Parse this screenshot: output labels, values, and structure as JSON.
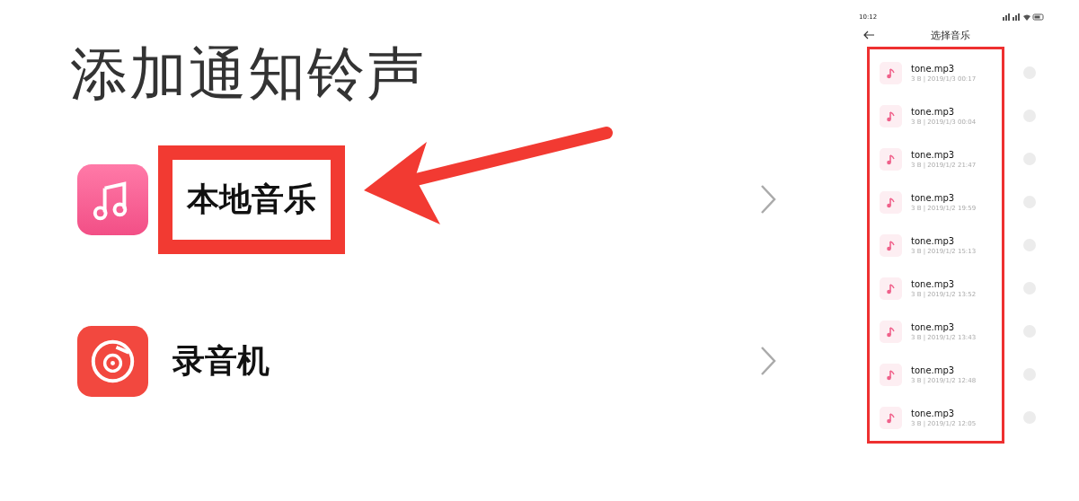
{
  "title": "添加通知铃声",
  "sources": [
    {
      "kind": "music",
      "label": "本地音乐",
      "highlighted": true
    },
    {
      "kind": "recorder",
      "label": "录音机",
      "highlighted": false
    }
  ],
  "phone": {
    "status_bar": {
      "time": "10:12"
    },
    "header": {
      "title": "选择音乐"
    },
    "list_highlighted": true,
    "files": [
      {
        "name": "tone.mp3",
        "meta": "3 B | 2019/1/3 00:17",
        "selected": false
      },
      {
        "name": "tone.mp3",
        "meta": "3 B | 2019/1/3 00:04",
        "selected": false
      },
      {
        "name": "tone.mp3",
        "meta": "3 B | 2019/1/2 21:47",
        "selected": false
      },
      {
        "name": "tone.mp3",
        "meta": "3 B | 2019/1/2 19:59",
        "selected": false
      },
      {
        "name": "tone.mp3",
        "meta": "3 B | 2019/1/2 15:13",
        "selected": false
      },
      {
        "name": "tone.mp3",
        "meta": "3 B | 2019/1/2 13:52",
        "selected": false
      },
      {
        "name": "tone.mp3",
        "meta": "3 B | 2019/1/2 13:43",
        "selected": false
      },
      {
        "name": "tone.mp3",
        "meta": "3 B | 2019/1/2 12:48",
        "selected": false
      },
      {
        "name": "tone.mp3",
        "meta": "3 B | 2019/1/2 12:05",
        "selected": false
      }
    ]
  }
}
